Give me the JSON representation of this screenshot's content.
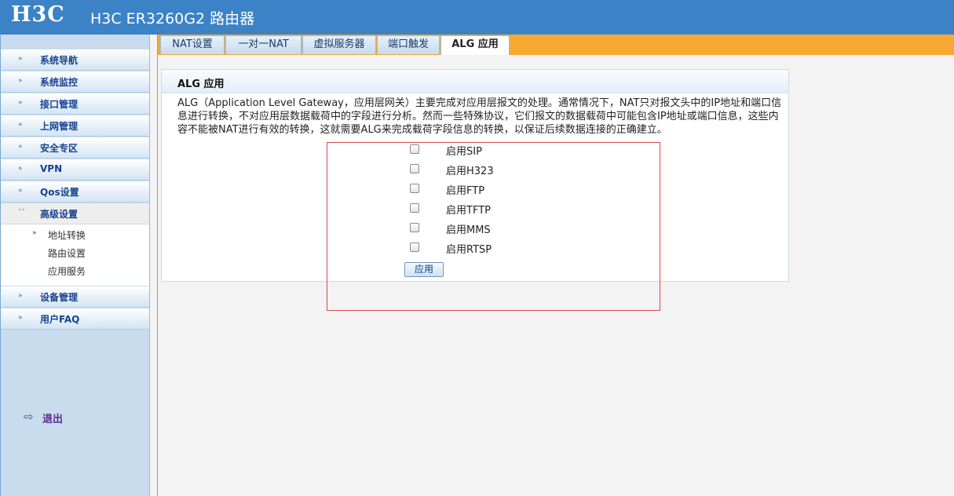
{
  "header": {
    "logo": "H3C",
    "title": "H3C ER3260G2 路由器"
  },
  "sidebar": {
    "items": [
      {
        "label": "系统导航"
      },
      {
        "label": "系统监控"
      },
      {
        "label": "接口管理"
      },
      {
        "label": "上网管理"
      },
      {
        "label": "安全专区"
      },
      {
        "label": "VPN"
      },
      {
        "label": "Qos设置"
      },
      {
        "label": "高级设置"
      },
      {
        "label": "设备管理"
      },
      {
        "label": "用户FAQ"
      }
    ],
    "sub_items": [
      {
        "label": "地址转换"
      },
      {
        "label": "路由设置"
      },
      {
        "label": "应用服务"
      }
    ],
    "logout": "退出"
  },
  "tabs": [
    {
      "label": "NAT设置"
    },
    {
      "label": "一对一NAT"
    },
    {
      "label": "虚拟服务器"
    },
    {
      "label": "端口触发"
    },
    {
      "label": "ALG 应用"
    }
  ],
  "panel": {
    "title": "ALG 应用",
    "description": "ALG（Application Level Gateway，应用层网关）主要完成对应用层报文的处理。通常情况下，NAT只对报文头中的IP地址和端口信息进行转换，不对应用层数据载荷中的字段进行分析。然而一些特殊协议，它们报文的数据载荷中可能包含IP地址或端口信息，这些内容不能被NAT进行有效的转换，这就需要ALG来完成载荷字段信息的转换，以保证后续数据连接的正确建立。",
    "options": [
      {
        "label": "启用SIP"
      },
      {
        "label": "启用H323"
      },
      {
        "label": "启用FTP"
      },
      {
        "label": "启用TFTP"
      },
      {
        "label": "启用MMS"
      },
      {
        "label": "启用RTSP"
      }
    ],
    "apply_label": "应用"
  }
}
